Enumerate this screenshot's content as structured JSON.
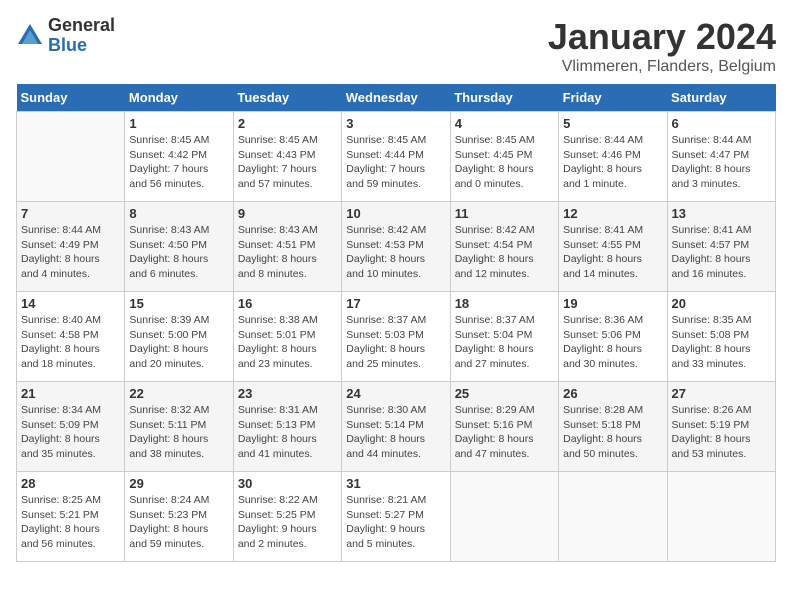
{
  "logo": {
    "general": "General",
    "blue": "Blue"
  },
  "header": {
    "month": "January 2024",
    "location": "Vlimmeren, Flanders, Belgium"
  },
  "columns": [
    "Sunday",
    "Monday",
    "Tuesday",
    "Wednesday",
    "Thursday",
    "Friday",
    "Saturday"
  ],
  "weeks": [
    [
      {
        "day": "",
        "info": ""
      },
      {
        "day": "1",
        "info": "Sunrise: 8:45 AM\nSunset: 4:42 PM\nDaylight: 7 hours\nand 56 minutes."
      },
      {
        "day": "2",
        "info": "Sunrise: 8:45 AM\nSunset: 4:43 PM\nDaylight: 7 hours\nand 57 minutes."
      },
      {
        "day": "3",
        "info": "Sunrise: 8:45 AM\nSunset: 4:44 PM\nDaylight: 7 hours\nand 59 minutes."
      },
      {
        "day": "4",
        "info": "Sunrise: 8:45 AM\nSunset: 4:45 PM\nDaylight: 8 hours\nand 0 minutes."
      },
      {
        "day": "5",
        "info": "Sunrise: 8:44 AM\nSunset: 4:46 PM\nDaylight: 8 hours\nand 1 minute."
      },
      {
        "day": "6",
        "info": "Sunrise: 8:44 AM\nSunset: 4:47 PM\nDaylight: 8 hours\nand 3 minutes."
      }
    ],
    [
      {
        "day": "7",
        "info": "Sunrise: 8:44 AM\nSunset: 4:49 PM\nDaylight: 8 hours\nand 4 minutes."
      },
      {
        "day": "8",
        "info": "Sunrise: 8:43 AM\nSunset: 4:50 PM\nDaylight: 8 hours\nand 6 minutes."
      },
      {
        "day": "9",
        "info": "Sunrise: 8:43 AM\nSunset: 4:51 PM\nDaylight: 8 hours\nand 8 minutes."
      },
      {
        "day": "10",
        "info": "Sunrise: 8:42 AM\nSunset: 4:53 PM\nDaylight: 8 hours\nand 10 minutes."
      },
      {
        "day": "11",
        "info": "Sunrise: 8:42 AM\nSunset: 4:54 PM\nDaylight: 8 hours\nand 12 minutes."
      },
      {
        "day": "12",
        "info": "Sunrise: 8:41 AM\nSunset: 4:55 PM\nDaylight: 8 hours\nand 14 minutes."
      },
      {
        "day": "13",
        "info": "Sunrise: 8:41 AM\nSunset: 4:57 PM\nDaylight: 8 hours\nand 16 minutes."
      }
    ],
    [
      {
        "day": "14",
        "info": "Sunrise: 8:40 AM\nSunset: 4:58 PM\nDaylight: 8 hours\nand 18 minutes."
      },
      {
        "day": "15",
        "info": "Sunrise: 8:39 AM\nSunset: 5:00 PM\nDaylight: 8 hours\nand 20 minutes."
      },
      {
        "day": "16",
        "info": "Sunrise: 8:38 AM\nSunset: 5:01 PM\nDaylight: 8 hours\nand 23 minutes."
      },
      {
        "day": "17",
        "info": "Sunrise: 8:37 AM\nSunset: 5:03 PM\nDaylight: 8 hours\nand 25 minutes."
      },
      {
        "day": "18",
        "info": "Sunrise: 8:37 AM\nSunset: 5:04 PM\nDaylight: 8 hours\nand 27 minutes."
      },
      {
        "day": "19",
        "info": "Sunrise: 8:36 AM\nSunset: 5:06 PM\nDaylight: 8 hours\nand 30 minutes."
      },
      {
        "day": "20",
        "info": "Sunrise: 8:35 AM\nSunset: 5:08 PM\nDaylight: 8 hours\nand 33 minutes."
      }
    ],
    [
      {
        "day": "21",
        "info": "Sunrise: 8:34 AM\nSunset: 5:09 PM\nDaylight: 8 hours\nand 35 minutes."
      },
      {
        "day": "22",
        "info": "Sunrise: 8:32 AM\nSunset: 5:11 PM\nDaylight: 8 hours\nand 38 minutes."
      },
      {
        "day": "23",
        "info": "Sunrise: 8:31 AM\nSunset: 5:13 PM\nDaylight: 8 hours\nand 41 minutes."
      },
      {
        "day": "24",
        "info": "Sunrise: 8:30 AM\nSunset: 5:14 PM\nDaylight: 8 hours\nand 44 minutes."
      },
      {
        "day": "25",
        "info": "Sunrise: 8:29 AM\nSunset: 5:16 PM\nDaylight: 8 hours\nand 47 minutes."
      },
      {
        "day": "26",
        "info": "Sunrise: 8:28 AM\nSunset: 5:18 PM\nDaylight: 8 hours\nand 50 minutes."
      },
      {
        "day": "27",
        "info": "Sunrise: 8:26 AM\nSunset: 5:19 PM\nDaylight: 8 hours\nand 53 minutes."
      }
    ],
    [
      {
        "day": "28",
        "info": "Sunrise: 8:25 AM\nSunset: 5:21 PM\nDaylight: 8 hours\nand 56 minutes."
      },
      {
        "day": "29",
        "info": "Sunrise: 8:24 AM\nSunset: 5:23 PM\nDaylight: 8 hours\nand 59 minutes."
      },
      {
        "day": "30",
        "info": "Sunrise: 8:22 AM\nSunset: 5:25 PM\nDaylight: 9 hours\nand 2 minutes."
      },
      {
        "day": "31",
        "info": "Sunrise: 8:21 AM\nSunset: 5:27 PM\nDaylight: 9 hours\nand 5 minutes."
      },
      {
        "day": "",
        "info": ""
      },
      {
        "day": "",
        "info": ""
      },
      {
        "day": "",
        "info": ""
      }
    ]
  ]
}
